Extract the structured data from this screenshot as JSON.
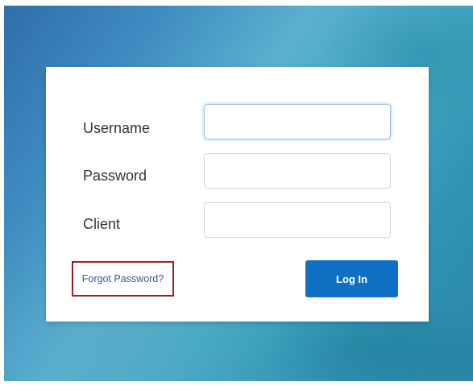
{
  "form": {
    "username_label": "Username",
    "password_label": "Password",
    "client_label": "Client",
    "username_value": "",
    "password_value": "",
    "client_value": "",
    "forgot_password_link": "Forgot Password?",
    "login_button": "Log In"
  },
  "colors": {
    "accent_button": "#0f70c4",
    "link": "#2f5a94",
    "highlight_box": "#a31d24",
    "focus_ring": "#9cc2ea"
  }
}
